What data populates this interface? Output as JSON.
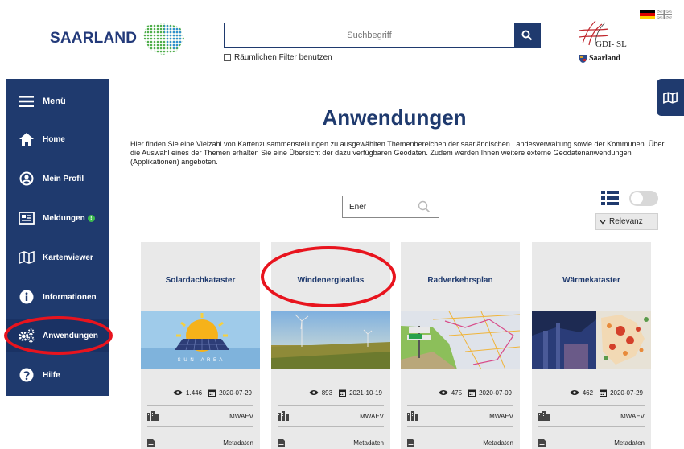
{
  "header": {
    "logo_text": "SAARLAND",
    "search_placeholder": "Suchbegriff",
    "spatial_filter_label": "Räumlichen Filter benutzen",
    "gdi_text": "GDI- SL",
    "gdi_sub": "Saarland"
  },
  "sidebar": {
    "items": [
      {
        "label": "Menü",
        "icon": "hamburger-icon"
      },
      {
        "label": "Home",
        "icon": "home-icon"
      },
      {
        "label": "Mein Profil",
        "icon": "user-icon"
      },
      {
        "label": "Meldungen",
        "icon": "newspaper-icon",
        "badge": "!"
      },
      {
        "label": "Kartenviewer",
        "icon": "map-icon"
      },
      {
        "label": "Informationen",
        "icon": "info-icon"
      },
      {
        "label": "Anwendungen",
        "icon": "gears-icon"
      },
      {
        "label": "Hilfe",
        "icon": "help-icon"
      }
    ]
  },
  "main": {
    "title": "Anwendungen",
    "intro": "Hier finden Sie eine Vielzahl von Kartenzusammenstellungen zu ausgewählten Themenbereichen der saarländischen Landesverwaltung sowie der Kommunen. Über die Auswahl eines der Themen erhalten Sie eine Übersicht der dazu verfügbaren Geodaten. Zudem werden Ihnen weitere externe Geodatenanwendungen (Applikationen) angeboten.",
    "filter_value": "Ener",
    "sort_label": "Relevanz",
    "metadata_label": "Metadaten"
  },
  "cards": [
    {
      "title": "Solardachkataster",
      "views": "1.446",
      "date": "2020-07-29",
      "org": "MWAEV",
      "image_caption": "S U N · A R E A"
    },
    {
      "title": "Windenergieatlas",
      "views": "893",
      "date": "2021-10-19",
      "org": "MWAEV"
    },
    {
      "title": "Radverkehrsplan",
      "views": "475",
      "date": "2020-07-09",
      "org": "MWAEV"
    },
    {
      "title": "Wärmekataster",
      "views": "462",
      "date": "2020-07-29",
      "org": "MWAEV"
    }
  ],
  "colors": {
    "primary": "#1f3a6e",
    "highlight": "#e8141e",
    "badge": "#3dbb4f",
    "card_bg": "#e9e9e9"
  }
}
